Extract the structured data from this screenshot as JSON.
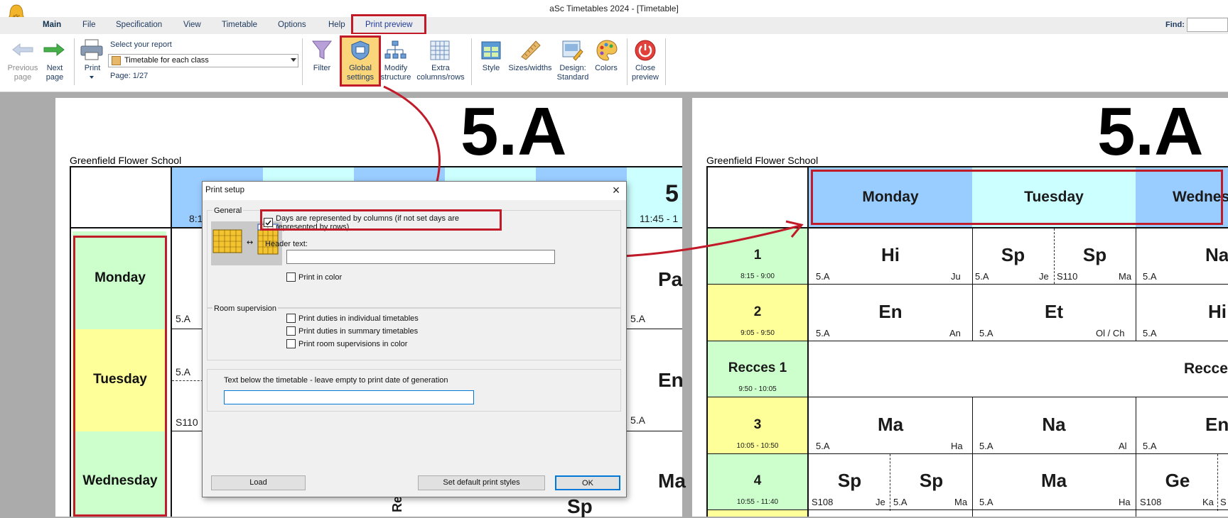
{
  "app": {
    "title": "aSc Timetables 2024  - [Timetable]"
  },
  "menu": {
    "items": [
      "Main",
      "File",
      "Specification",
      "View",
      "Timetable",
      "Options",
      "Help",
      "Print preview"
    ],
    "find_label": "Find:"
  },
  "ribbon": {
    "previous_page": [
      "Previous",
      "page"
    ],
    "next_page": [
      "Next",
      "page"
    ],
    "print": "Print",
    "select_report_label": "Select your report",
    "report_value": "Timetable for each class",
    "page_info": "Page: 1/27",
    "filter": "Filter",
    "global_settings": [
      "Global",
      "settings"
    ],
    "modify_structure": [
      "Modify",
      "structure"
    ],
    "extra": [
      "Extra",
      "columns/rows"
    ],
    "style": "Style",
    "sizes": "Sizes/widths",
    "design": [
      "Design:",
      "Standard"
    ],
    "colors": "Colors",
    "close_preview": [
      "Close",
      "preview"
    ]
  },
  "left_page": {
    "class_title": "5.A",
    "school": "Greenfield Flower School",
    "days": [
      "Monday",
      "Tuesday",
      "Wednesday"
    ],
    "times": [
      "8:1",
      "11:45 - 1"
    ],
    "fragments": [
      "5.A",
      "5.A",
      "S110",
      "Pa",
      "En",
      "Ma",
      "Sp",
      "5.A",
      "5.A",
      "Re",
      "5"
    ]
  },
  "right_page": {
    "class_title": "5.A",
    "school": "Greenfield Flower School",
    "days": [
      "Monday",
      "Tuesday",
      "Wednes"
    ],
    "periods": [
      {
        "name": "1",
        "time": "8:15 - 9:00"
      },
      {
        "name": "2",
        "time": "9:05 - 9:50"
      },
      {
        "name": "Recces 1",
        "time": "9:50 - 10:05"
      },
      {
        "name": "3",
        "time": "10:05 - 10:50"
      },
      {
        "name": "4",
        "time": "10:55 - 11:40"
      }
    ],
    "recess_label": "Recce",
    "cells": {
      "r1_mon": {
        "subject": "Hi",
        "class": "5.A",
        "teacher": "Ju"
      },
      "r1_tue_a": {
        "subject": "Sp",
        "class": "5.A",
        "teacher": "Je"
      },
      "r1_tue_b": {
        "subject": "Sp",
        "room": "S110",
        "teacher": "Ma"
      },
      "r1_wed": {
        "subject": "Na",
        "class": "5.A"
      },
      "r2_mon": {
        "subject": "En",
        "class": "5.A",
        "teacher": "An"
      },
      "r2_tue": {
        "subject": "Et",
        "class": "5.A",
        "teacher": "Ol / Ch"
      },
      "r2_wed": {
        "subject": "Hi",
        "class": "5.A"
      },
      "r3_mon": {
        "subject": "Ma",
        "class": "5.A",
        "teacher": "Ha"
      },
      "r3_tue": {
        "subject": "Na",
        "class": "5.A",
        "teacher": "Al"
      },
      "r3_wed": {
        "subject": "En",
        "class": "5.A"
      },
      "r4_mon_a": {
        "subject": "Sp",
        "room": "S108",
        "teacher": "Je"
      },
      "r4_mon_b": {
        "subject": "Sp",
        "class": "5.A",
        "teacher": "Ma"
      },
      "r4_tue": {
        "subject": "Ma",
        "class": "5.A",
        "teacher": "Ha"
      },
      "r4_wed": {
        "subject": "Ge",
        "room": "S108",
        "teacher": "Ka",
        "extra": "S"
      }
    }
  },
  "dialog": {
    "title": "Print setup",
    "general_label": "General",
    "days_columns_label": "Days are represented by columns (if not set days are represented by rows)",
    "days_columns_checked": true,
    "header_text_label": "Header text:",
    "header_text_value": "",
    "print_in_color_label": "Print in color",
    "room_supervision_label": "Room supervision",
    "duties_individual_label": "Print duties in individual timetables",
    "duties_summary_label": "Print duties in summary timetables",
    "room_supervisions_color_label": "Print room supervisions in color",
    "text_below_label": "Text below the timetable - leave empty to print date of generation",
    "text_below_value": "",
    "load_button": "Load",
    "default_styles_button": "Set default print styles",
    "ok_button": "OK"
  },
  "colors": {
    "highlight": "#c11b2a",
    "green": "#ccffcc",
    "yellow": "#ffff99",
    "blue": "#99ccff",
    "cyan": "#ccffff"
  }
}
